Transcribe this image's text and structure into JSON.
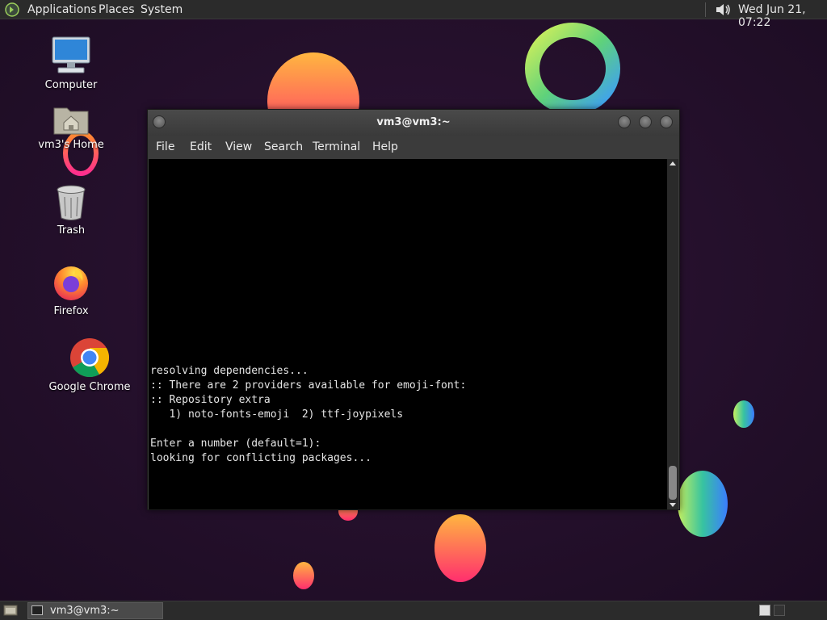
{
  "top_panel": {
    "menus": [
      "Applications",
      "Places",
      "System"
    ],
    "clock": "Wed Jun 21, 07:22",
    "volume_icon": "speaker-icon"
  },
  "desktop_icons": [
    {
      "label": "Computer",
      "icon": "computer-icon"
    },
    {
      "label": "vm3's Home",
      "icon": "home-folder-icon"
    },
    {
      "label": "Trash",
      "icon": "trash-icon"
    },
    {
      "label": "Firefox",
      "icon": "firefox-icon"
    },
    {
      "label": "Google Chrome",
      "icon": "chrome-icon"
    }
  ],
  "terminal": {
    "title": "vm3@vm3:~",
    "menu": [
      "File",
      "Edit",
      "View",
      "Search",
      "Terminal",
      "Help"
    ],
    "lines": [
      "resolving dependencies...",
      ":: There are 2 providers available for emoji-font:",
      ":: Repository extra",
      "   1) noto-fonts-emoji  2) ttf-joypixels",
      "",
      "Enter a number (default=1):",
      "looking for conflicting packages..."
    ]
  },
  "bottom_panel": {
    "task": "vm3@vm3:~"
  },
  "colors": {
    "desktop_bg": "#22102a",
    "terminal_bg": "#000000",
    "panel_bg": "#2b2b2b"
  }
}
